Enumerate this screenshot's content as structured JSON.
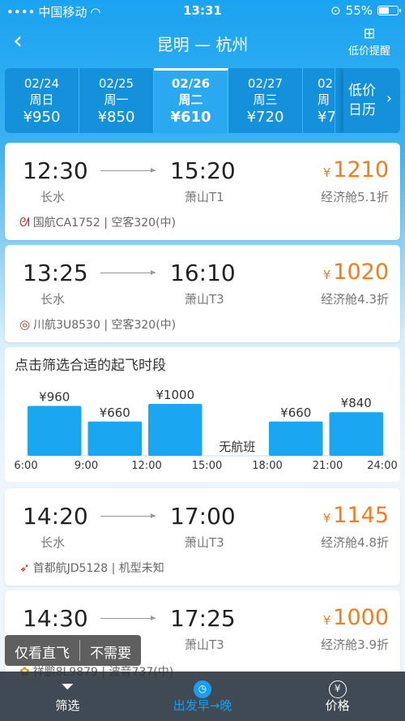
{
  "status": {
    "carrier": "中国移动",
    "time": "13:31",
    "battery": "55%",
    "battery_level": 0.55
  },
  "nav": {
    "back": "‹",
    "title": "昆明 — 杭州",
    "lowprice_label": "低价提醒"
  },
  "dates": [
    {
      "date": "02/24",
      "weekday": "周日",
      "price": "¥950",
      "active": false
    },
    {
      "date": "02/25",
      "weekday": "周一",
      "price": "¥850",
      "active": false
    },
    {
      "date": "02/26",
      "weekday": "周二",
      "price": "¥610",
      "active": true
    },
    {
      "date": "02/27",
      "weekday": "周三",
      "price": "¥720",
      "active": false
    },
    {
      "date": "02",
      "weekday": "周",
      "price": "¥7",
      "active": false
    }
  ],
  "calendar": {
    "line1": "低价",
    "line2": "日历"
  },
  "flights": [
    {
      "dep_time": "12:30",
      "arr_time": "15:20",
      "dep_airport": "长水",
      "arr_airport": "萧山T1",
      "price": "1210",
      "currency": "¥",
      "cabin": "经济舱5.1折",
      "airline": "国航CA1752 | 空客320(中)"
    },
    {
      "dep_time": "13:25",
      "arr_time": "16:10",
      "dep_airport": "长水",
      "arr_airport": "萧山T3",
      "price": "1020",
      "currency": "¥",
      "cabin": "经济舱4.3折",
      "airline": "川航3U8530 | 空客320(中)"
    },
    {
      "dep_time": "14:20",
      "arr_time": "17:00",
      "dep_airport": "长水",
      "arr_airport": "萧山T3",
      "price": "1145",
      "currency": "¥",
      "cabin": "经济舱4.8折",
      "airline": "首都航JD5128 | 机型未知"
    },
    {
      "dep_time": "14:30",
      "arr_time": "17:25",
      "dep_airport": "",
      "arr_airport": "萧山T3",
      "price": "1000",
      "currency": "¥",
      "cabin": "经济舱3.9折",
      "airline": "祥鹏8L9879 | 波音737(中)"
    }
  ],
  "chart_title": "点击筛选合适的起飞时段",
  "chart_data": {
    "type": "bar",
    "categories": [
      "6:00-9:00",
      "9:00-12:00",
      "12:00-15:00",
      "15:00-18:00",
      "18:00-21:00",
      "21:00-24:00"
    ],
    "values": [
      960,
      660,
      1000,
      null,
      660,
      840
    ],
    "value_labels": [
      "¥960",
      "¥660",
      "¥1000",
      "",
      "¥660",
      "¥840"
    ],
    "empty_label": "无航班",
    "tick_labels": [
      "6:00",
      "9:00",
      "12:00",
      "15:00",
      "18:00",
      "21:00",
      "24:00"
    ],
    "bar_color": "#1aa6f0"
  },
  "pill": {
    "direct_only": "仅看直飞",
    "no_need": "不需要"
  },
  "bottom_tabs": [
    {
      "label": "筛选",
      "icon": "funnel-icon",
      "active": false
    },
    {
      "label": "出发早→晚",
      "icon": "clock-icon",
      "active": true
    },
    {
      "label": "价格",
      "icon": "yen-icon",
      "active": false
    }
  ],
  "colors": {
    "accent": "#1a9ff0",
    "price": "#fb7a18"
  }
}
